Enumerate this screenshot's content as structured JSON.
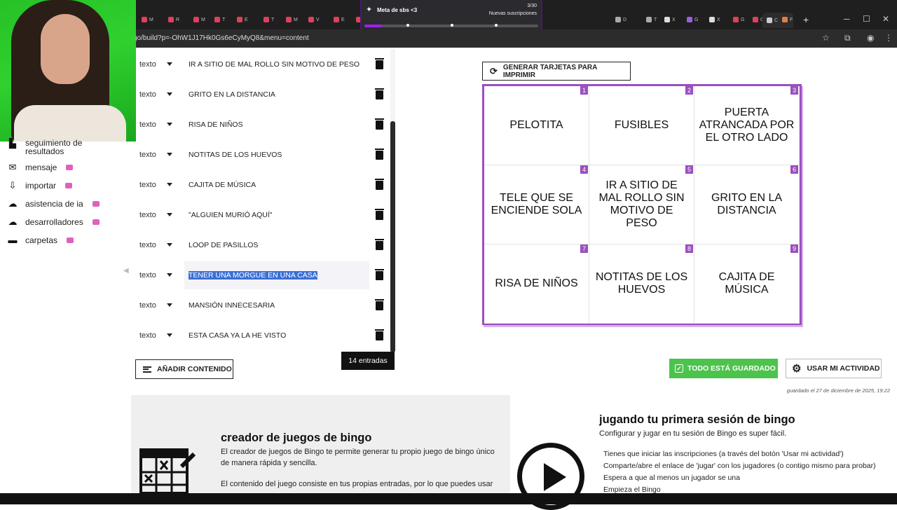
{
  "browser": {
    "url": "go/build?p=-OhW1J17Hk0Gs6eCyMyQ8&menu=content",
    "tabs": [
      "M",
      "R",
      "M",
      "T",
      "E",
      "T",
      "M",
      "V",
      "E",
      "T",
      "M",
      "E",
      "D",
      "T",
      "X",
      "G",
      "X",
      "G",
      "G",
      "C",
      "F"
    ],
    "new_tab": "+",
    "minimize": "─",
    "maximize": "☐",
    "close": "✕"
  },
  "stream_alert": {
    "title": "Meta de sbs <3",
    "count": "3/30",
    "label": "Nuevas suscripciones",
    "progress": 0.1
  },
  "sidebar": {
    "items": [
      {
        "label": "seguimiento de resultados",
        "icon": "chart-icon"
      },
      {
        "label": "mensaje",
        "icon": "envelope-icon"
      },
      {
        "label": "importar",
        "icon": "import-icon"
      },
      {
        "label": "asistencia de ia",
        "icon": "brain-icon"
      },
      {
        "label": "desarrolladores",
        "icon": "cloud-icon"
      },
      {
        "label": "carpetas",
        "icon": "folder-icon"
      }
    ]
  },
  "entries": [
    {
      "type": "texto",
      "text": "IR A SITIO DE MAL ROLLO SIN MOTIVO DE PESO"
    },
    {
      "type": "texto",
      "text": "GRITO EN LA DISTANCIA"
    },
    {
      "type": "texto",
      "text": "RISA DE NIÑOS"
    },
    {
      "type": "texto",
      "text": "NOTITAS DE LOS HUEVOS"
    },
    {
      "type": "texto",
      "text": "CAJITA DE MÚSICA"
    },
    {
      "type": "texto",
      "text": "\"ALGUIEN MURIÓ AQUÍ\""
    },
    {
      "type": "texto",
      "text": "LOOP DE PASILLOS"
    },
    {
      "type": "texto",
      "text": "TENER UNA MORGUE EN UNA CASA"
    },
    {
      "type": "texto",
      "text": "MANSIÓN INNECESARIA"
    },
    {
      "type": "texto",
      "text": "ESTA CASA YA LA HE VISTO"
    }
  ],
  "generate_button": "GENERAR TARJETAS PARA IMPRIMIR",
  "bingo_card": [
    {
      "n": "1",
      "text": "PELOTITA"
    },
    {
      "n": "2",
      "text": "FUSIBLES"
    },
    {
      "n": "3",
      "text": "PUERTA ATRANCADA POR EL OTRO LADO"
    },
    {
      "n": "4",
      "text": "TELE QUE SE ENCIENDE SOLA"
    },
    {
      "n": "5",
      "text": "IR A SITIO DE MAL ROLLO SIN MOTIVO DE PESO"
    },
    {
      "n": "6",
      "text": "GRITO EN LA DISTANCIA"
    },
    {
      "n": "7",
      "text": "RISA DE NIÑOS"
    },
    {
      "n": "8",
      "text": "NOTITAS DE LOS HUEVOS"
    },
    {
      "n": "9",
      "text": "CAJITA DE MÚSICA"
    }
  ],
  "add_content": "AÑADIR CONTENIDO",
  "entries_count": "14 entradas",
  "saved_button": "TODO ESTÁ GUARDADO",
  "use_button": "USAR MI ACTIVIDAD",
  "saved_at": "guardado el 27 de diciembre de 2025, 19:22",
  "info_left": {
    "title": "creador de juegos de bingo",
    "p1": "El creador de juegos de Bingo te permite generar tu propio juego de bingo único de manera rápida y sencilla.",
    "p2": "El contenido del juego consiste en tus propias entradas, por lo que puedes usar"
  },
  "info_right": {
    "title": "jugando tu primera sesión de bingo",
    "subtitle": "Configurar y jugar en tu sesión de Bingo es super fácil.",
    "steps": [
      "Tienes que iniciar las inscripciones (a través del botón 'Usar mi actividad')",
      "Comparte/abre el enlace de 'jugar' con los jugadores (o contigo mismo para probar)",
      "Espera a que al menos un jugador se una",
      "Empieza el Bingo"
    ]
  },
  "colors": {
    "accent": "#9b4fc0",
    "saved": "#4cc34c",
    "pro_badge": "#e060c0"
  }
}
